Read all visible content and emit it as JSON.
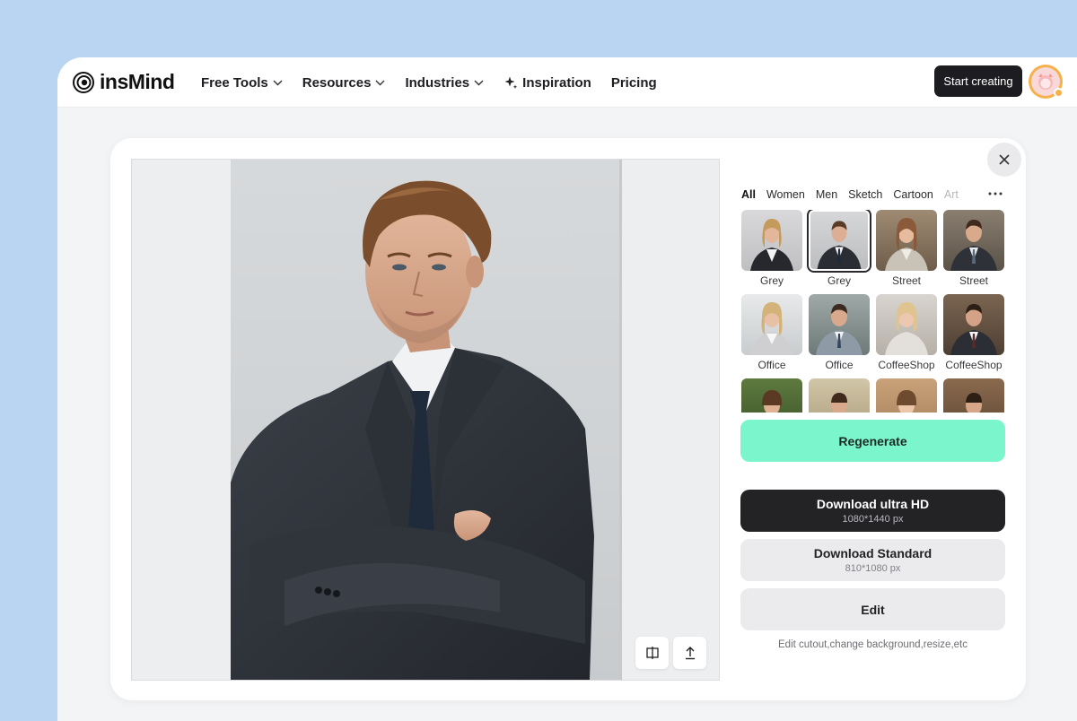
{
  "header": {
    "logo_text": "insMind",
    "nav": [
      {
        "label": "Free Tools",
        "icon": "chevron-down-icon"
      },
      {
        "label": "Resources",
        "icon": "chevron-down-icon"
      },
      {
        "label": "Industries",
        "icon": "chevron-down-icon"
      },
      {
        "label": "Inspiration",
        "icon": "sparkle-icon"
      },
      {
        "label": "Pricing"
      }
    ],
    "start_button": "Start creating"
  },
  "categories": {
    "items": [
      "All",
      "Women",
      "Men",
      "Sketch",
      "Cartoon",
      "Art"
    ],
    "active": "All"
  },
  "styles": [
    {
      "label": "Grey",
      "selected": false
    },
    {
      "label": "Grey",
      "selected": true
    },
    {
      "label": "Street",
      "selected": false
    },
    {
      "label": "Street",
      "selected": false
    },
    {
      "label": "Office",
      "selected": false
    },
    {
      "label": "Office",
      "selected": false
    },
    {
      "label": "CoffeeShop",
      "selected": false
    },
    {
      "label": "CoffeeShop",
      "selected": false
    },
    {
      "label": "",
      "selected": false
    },
    {
      "label": "",
      "selected": false
    },
    {
      "label": "",
      "selected": false
    },
    {
      "label": "",
      "selected": false
    }
  ],
  "actions": {
    "regenerate": "Regenerate",
    "download_hd": {
      "title": "Download ultra HD",
      "size": "1080*1440 px"
    },
    "download_std": {
      "title": "Download Standard",
      "size": "810*1080 px"
    },
    "edit": "Edit",
    "hint": "Edit cutout,change background,resize,etc"
  },
  "colors": {
    "accent": "#7bf5cc",
    "dark_button": "#232326",
    "page_bg": "#b9d5f1"
  }
}
